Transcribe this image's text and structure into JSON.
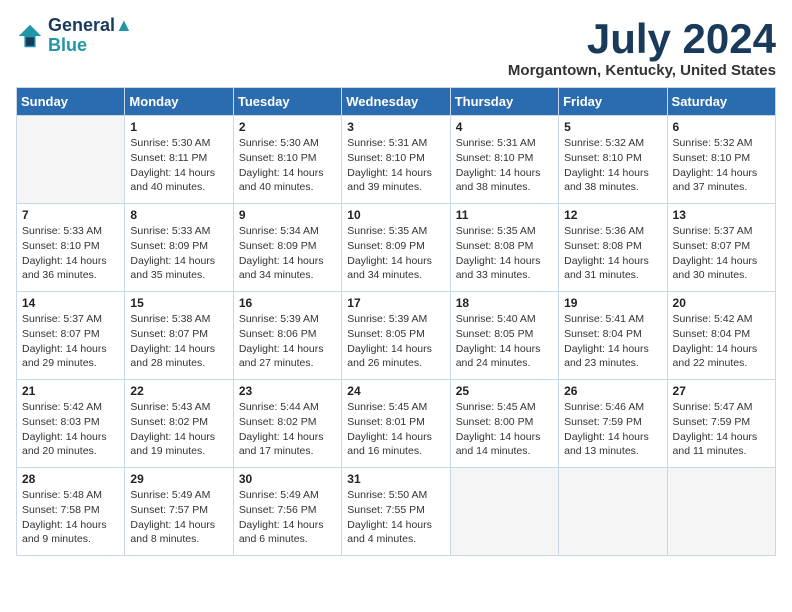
{
  "header": {
    "logo_line1": "General",
    "logo_line2": "Blue",
    "month_year": "July 2024",
    "location": "Morgantown, Kentucky, United States"
  },
  "days_of_week": [
    "Sunday",
    "Monday",
    "Tuesday",
    "Wednesday",
    "Thursday",
    "Friday",
    "Saturday"
  ],
  "weeks": [
    [
      {
        "day": "",
        "empty": true
      },
      {
        "day": "1",
        "sunrise": "5:30 AM",
        "sunset": "8:11 PM",
        "daylight": "14 hours and 40 minutes."
      },
      {
        "day": "2",
        "sunrise": "5:30 AM",
        "sunset": "8:10 PM",
        "daylight": "14 hours and 40 minutes."
      },
      {
        "day": "3",
        "sunrise": "5:31 AM",
        "sunset": "8:10 PM",
        "daylight": "14 hours and 39 minutes."
      },
      {
        "day": "4",
        "sunrise": "5:31 AM",
        "sunset": "8:10 PM",
        "daylight": "14 hours and 38 minutes."
      },
      {
        "day": "5",
        "sunrise": "5:32 AM",
        "sunset": "8:10 PM",
        "daylight": "14 hours and 38 minutes."
      },
      {
        "day": "6",
        "sunrise": "5:32 AM",
        "sunset": "8:10 PM",
        "daylight": "14 hours and 37 minutes."
      }
    ],
    [
      {
        "day": "7",
        "sunrise": "5:33 AM",
        "sunset": "8:10 PM",
        "daylight": "14 hours and 36 minutes."
      },
      {
        "day": "8",
        "sunrise": "5:33 AM",
        "sunset": "8:09 PM",
        "daylight": "14 hours and 35 minutes."
      },
      {
        "day": "9",
        "sunrise": "5:34 AM",
        "sunset": "8:09 PM",
        "daylight": "14 hours and 34 minutes."
      },
      {
        "day": "10",
        "sunrise": "5:35 AM",
        "sunset": "8:09 PM",
        "daylight": "14 hours and 34 minutes."
      },
      {
        "day": "11",
        "sunrise": "5:35 AM",
        "sunset": "8:08 PM",
        "daylight": "14 hours and 33 minutes."
      },
      {
        "day": "12",
        "sunrise": "5:36 AM",
        "sunset": "8:08 PM",
        "daylight": "14 hours and 31 minutes."
      },
      {
        "day": "13",
        "sunrise": "5:37 AM",
        "sunset": "8:07 PM",
        "daylight": "14 hours and 30 minutes."
      }
    ],
    [
      {
        "day": "14",
        "sunrise": "5:37 AM",
        "sunset": "8:07 PM",
        "daylight": "14 hours and 29 minutes."
      },
      {
        "day": "15",
        "sunrise": "5:38 AM",
        "sunset": "8:07 PM",
        "daylight": "14 hours and 28 minutes."
      },
      {
        "day": "16",
        "sunrise": "5:39 AM",
        "sunset": "8:06 PM",
        "daylight": "14 hours and 27 minutes."
      },
      {
        "day": "17",
        "sunrise": "5:39 AM",
        "sunset": "8:05 PM",
        "daylight": "14 hours and 26 minutes."
      },
      {
        "day": "18",
        "sunrise": "5:40 AM",
        "sunset": "8:05 PM",
        "daylight": "14 hours and 24 minutes."
      },
      {
        "day": "19",
        "sunrise": "5:41 AM",
        "sunset": "8:04 PM",
        "daylight": "14 hours and 23 minutes."
      },
      {
        "day": "20",
        "sunrise": "5:42 AM",
        "sunset": "8:04 PM",
        "daylight": "14 hours and 22 minutes."
      }
    ],
    [
      {
        "day": "21",
        "sunrise": "5:42 AM",
        "sunset": "8:03 PM",
        "daylight": "14 hours and 20 minutes."
      },
      {
        "day": "22",
        "sunrise": "5:43 AM",
        "sunset": "8:02 PM",
        "daylight": "14 hours and 19 minutes."
      },
      {
        "day": "23",
        "sunrise": "5:44 AM",
        "sunset": "8:02 PM",
        "daylight": "14 hours and 17 minutes."
      },
      {
        "day": "24",
        "sunrise": "5:45 AM",
        "sunset": "8:01 PM",
        "daylight": "14 hours and 16 minutes."
      },
      {
        "day": "25",
        "sunrise": "5:45 AM",
        "sunset": "8:00 PM",
        "daylight": "14 hours and 14 minutes."
      },
      {
        "day": "26",
        "sunrise": "5:46 AM",
        "sunset": "7:59 PM",
        "daylight": "14 hours and 13 minutes."
      },
      {
        "day": "27",
        "sunrise": "5:47 AM",
        "sunset": "7:59 PM",
        "daylight": "14 hours and 11 minutes."
      }
    ],
    [
      {
        "day": "28",
        "sunrise": "5:48 AM",
        "sunset": "7:58 PM",
        "daylight": "14 hours and 9 minutes."
      },
      {
        "day": "29",
        "sunrise": "5:49 AM",
        "sunset": "7:57 PM",
        "daylight": "14 hours and 8 minutes."
      },
      {
        "day": "30",
        "sunrise": "5:49 AM",
        "sunset": "7:56 PM",
        "daylight": "14 hours and 6 minutes."
      },
      {
        "day": "31",
        "sunrise": "5:50 AM",
        "sunset": "7:55 PM",
        "daylight": "14 hours and 4 minutes."
      },
      {
        "day": "",
        "empty": true
      },
      {
        "day": "",
        "empty": true
      },
      {
        "day": "",
        "empty": true
      }
    ]
  ]
}
